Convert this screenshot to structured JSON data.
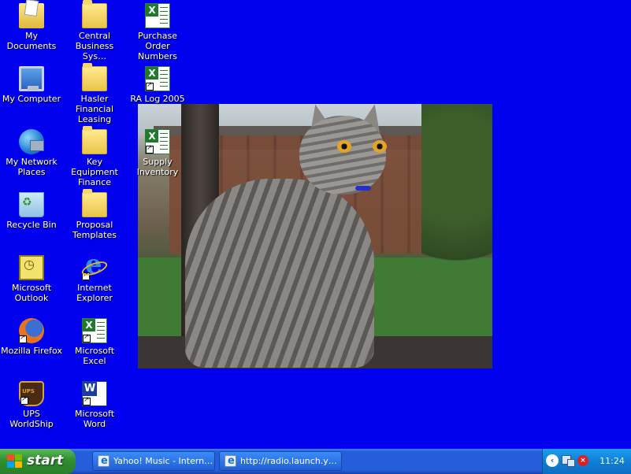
{
  "desktop": {
    "background_color": "#0000ee",
    "icons": [
      {
        "label": "My Documents",
        "icon": "my-documents-icon"
      },
      {
        "label": "Central Business Sys…",
        "icon": "folder-icon"
      },
      {
        "label": "Purchase Order Numbers",
        "icon": "excel-file-icon"
      },
      {
        "label": "My Computer",
        "icon": "my-computer-icon"
      },
      {
        "label": "Hasler Financial Leasing",
        "icon": "folder-icon"
      },
      {
        "label": "RA Log 2005",
        "icon": "excel-file-icon"
      },
      {
        "label": "My Network Places",
        "icon": "network-places-icon"
      },
      {
        "label": "Key Equipment Finance",
        "icon": "folder-icon"
      },
      {
        "label": "Supply Inventory",
        "icon": "excel-file-icon"
      },
      {
        "label": "Recycle Bin",
        "icon": "recycle-bin-icon"
      },
      {
        "label": "Proposal Templates",
        "icon": "folder-icon"
      },
      {
        "label": "Microsoft Outlook",
        "icon": "outlook-icon"
      },
      {
        "label": "Internet Explorer",
        "icon": "internet-explorer-icon"
      },
      {
        "label": "Mozilla Firefox",
        "icon": "firefox-icon"
      },
      {
        "label": "Microsoft Excel",
        "icon": "excel-icon"
      },
      {
        "label": "UPS WorldShip",
        "icon": "ups-icon"
      },
      {
        "label": "Microsoft Word",
        "icon": "word-icon"
      }
    ]
  },
  "taskbar": {
    "start_label": "start",
    "tasks": [
      {
        "label": "Yahoo! Music - Intern…",
        "icon": "internet-explorer-icon"
      },
      {
        "label": "http://radio.launch.y…",
        "icon": "internet-explorer-icon"
      }
    ],
    "tray": {
      "chevron": "‹",
      "clock": "11:24 AM"
    }
  }
}
